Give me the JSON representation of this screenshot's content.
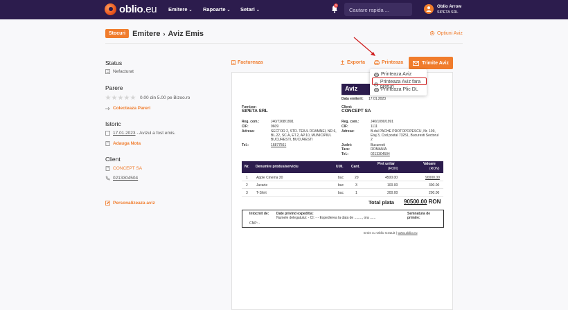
{
  "nav": {
    "logo_bold": "oblio",
    "logo_suffix": ".eu",
    "menu": [
      "Emitere",
      "Rapoarte",
      "Setari"
    ],
    "notifications_count": "1",
    "search_placeholder": "Cautare rapida ...",
    "user_name": "Oblio Arrow",
    "user_company": "SIPETA SRL"
  },
  "breadcrumb": {
    "button": "Stocuri",
    "level1": "Emitere",
    "level2": "Aviz Emis"
  },
  "options_link": "Optiuni Aviz",
  "sidebar": {
    "status_title": "Status",
    "status_value": "Nefacturat",
    "rating_title": "Parere",
    "rating_value": 0,
    "rating_text": "0.00 din 5.00 pe Bizoo.ro",
    "collect_reviews": "Colecteaza Pareri",
    "history_title": "Istoric",
    "history_date": "17.01.2023",
    "history_text": "- Avizul a fost emis.",
    "add_note": "Adauga Nota",
    "client_title": "Client",
    "client_name": "CONCEPT SA",
    "client_phone": "0213304504",
    "customize": "Personalizeaza aviz"
  },
  "toolbar": {
    "invoice": "Factureaza",
    "export": "Exporta",
    "print": "Printeaza",
    "send": "Trimite Aviz"
  },
  "print_menu": [
    "Printeaza Aviz",
    "Printeaza Aviz fara preturi",
    "Printeaza Plic DL"
  ],
  "document": {
    "title": "Aviz",
    "date_label": "Data emiterii:",
    "date": "17.01.2023",
    "supplier_label": "Furnizor:",
    "supplier": "SIPETA SRL",
    "client_label": "Client:",
    "client": "CONCEPT SA",
    "supplier_fields": [
      {
        "label": "Reg. com.:",
        "value": "J40/7268/1991"
      },
      {
        "label": "CIF:",
        "value": "9609"
      },
      {
        "label": "Adresa:",
        "value": "SECTOR 2, STR. TEIUL DOAMNEI, NR 6, BL.22, SC.A, ET.2, AP.10, MUNICIPIUL BUCURESTI, BUCURESTI"
      },
      {
        "label": "Tel.:",
        "value": "16877561"
      }
    ],
    "client_fields": [
      {
        "label": "Reg. com.:",
        "value": "J40/1090/1991"
      },
      {
        "label": "CIF:",
        "value": "1111"
      },
      {
        "label": "Adresa:",
        "value": "B-dul PACHE PROTOPOPESCU, Nr. 109, Etaj 3, Cod postal 73251, Bucuresti Sectorul 2"
      },
      {
        "label": "Judet:",
        "value": "Bucuresti"
      },
      {
        "label": "Tara:",
        "value": "ROMANIA"
      },
      {
        "label": "Tel.:",
        "value": "0213304504"
      }
    ],
    "columns": [
      "Nr.",
      "Denumire produs/serviciu",
      "U.M.",
      "Cant.",
      "Pret unitar",
      "(RON)",
      "Valoare",
      "(RON)"
    ],
    "rows": [
      {
        "nr": "1",
        "name": "Apple Cinema 30",
        "um": "buc",
        "qty": "20",
        "price": "4500.00",
        "value": "90000.00"
      },
      {
        "nr": "2",
        "name": "Jucarie",
        "um": "buc",
        "qty": "3",
        "price": "100.00",
        "value": "300.00"
      },
      {
        "nr": "3",
        "name": "T-Shirt",
        "um": "buc",
        "qty": "1",
        "price": "200.00",
        "value": "200.00"
      }
    ],
    "total_label": "Total plata",
    "total_value": "90500.00",
    "total_currency": "RON",
    "sig_delegate": "Intocmit de:",
    "sig_cnp": "CNP: -",
    "sig_expedition": "Date privind expeditia:",
    "sig_expedition_text": "Numele delegatului: - CI: - - Expedierea la data de ........, ora ......",
    "sig_receive": "Semnatura de primire:",
    "footer_text": "Emis cu Oblio Gratuit |",
    "footer_link": "www.oblio.eu"
  },
  "colors": {
    "nav_bg": "#2c1c4d",
    "accent": "#f07c2c",
    "highlight": "#d02020"
  }
}
